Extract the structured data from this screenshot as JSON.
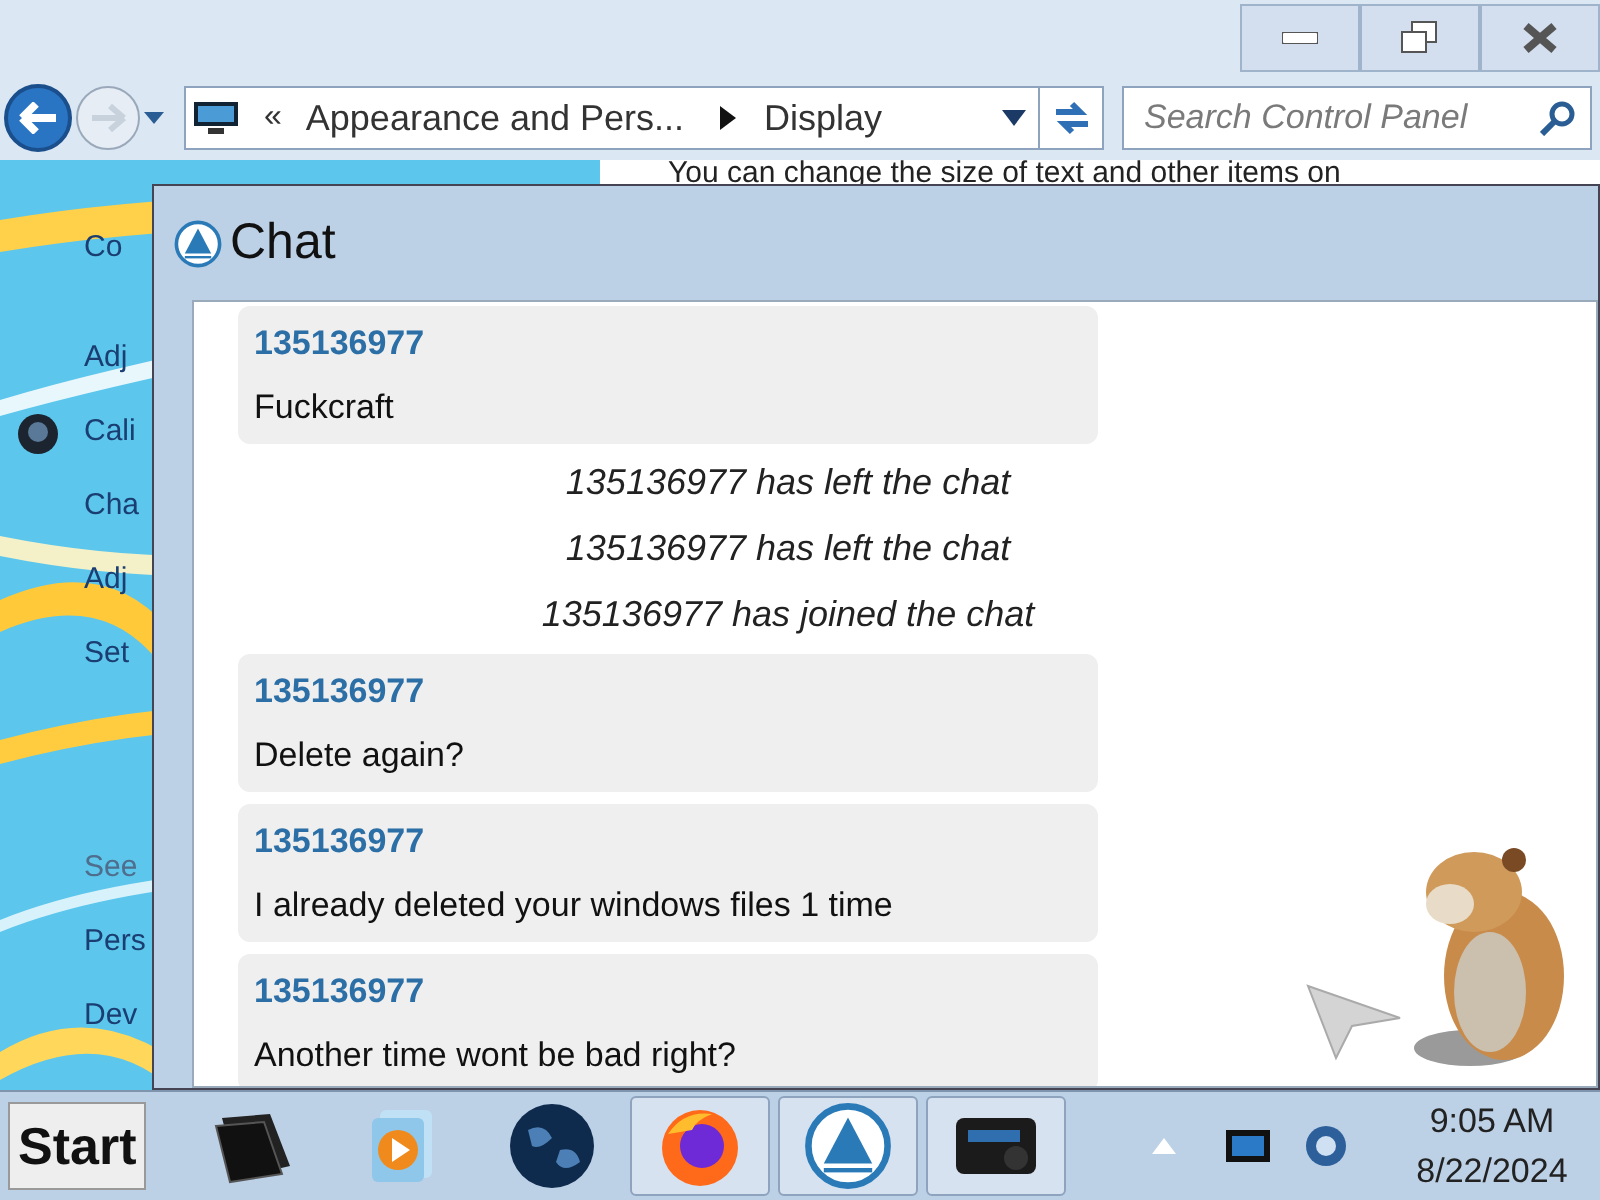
{
  "explorer": {
    "address": {
      "prefix": "«",
      "crumbs": [
        "Appearance and Pers...",
        "Display"
      ]
    },
    "search": {
      "placeholder": "Search Control Panel"
    },
    "sidebar": {
      "items": [
        {
          "kind": "link",
          "label": "Co"
        },
        {
          "kind": "link",
          "label": "Adj"
        },
        {
          "kind": "icon_link",
          "label": "Cali"
        },
        {
          "kind": "link",
          "label": "Cha"
        },
        {
          "kind": "link",
          "label": "Adj"
        },
        {
          "kind": "link",
          "label": "Set"
        },
        {
          "kind": "heading",
          "label": "See"
        },
        {
          "kind": "link",
          "label": "Pers"
        },
        {
          "kind": "link",
          "label": "Dev"
        }
      ]
    },
    "content_text": "You can change the size of text and other items on"
  },
  "chat": {
    "title": "Chat",
    "messages": [
      {
        "kind": "message",
        "sender": "135136977",
        "text": "Fuckcraft"
      },
      {
        "kind": "event",
        "text": "135136977 has left the chat"
      },
      {
        "kind": "event",
        "text": "135136977 has left the chat"
      },
      {
        "kind": "event",
        "text": "135136977 has joined the chat"
      },
      {
        "kind": "message",
        "sender": "135136977",
        "text": "Delete again?"
      },
      {
        "kind": "message",
        "sender": "135136977",
        "text": "I already deleted your windows files 1 time"
      },
      {
        "kind": "message",
        "sender": "135136977",
        "text": "Another time wont be bad right?"
      }
    ]
  },
  "taskbar": {
    "start": "Start",
    "apps": [
      {
        "kind": "files",
        "open": false
      },
      {
        "kind": "media",
        "open": false
      },
      {
        "kind": "globe",
        "open": false
      },
      {
        "kind": "firefox",
        "open": true
      },
      {
        "kind": "triangle",
        "open": true
      },
      {
        "kind": "device",
        "open": true
      }
    ],
    "clock": {
      "time": "9:05 AM",
      "date": "8/22/2024"
    }
  }
}
